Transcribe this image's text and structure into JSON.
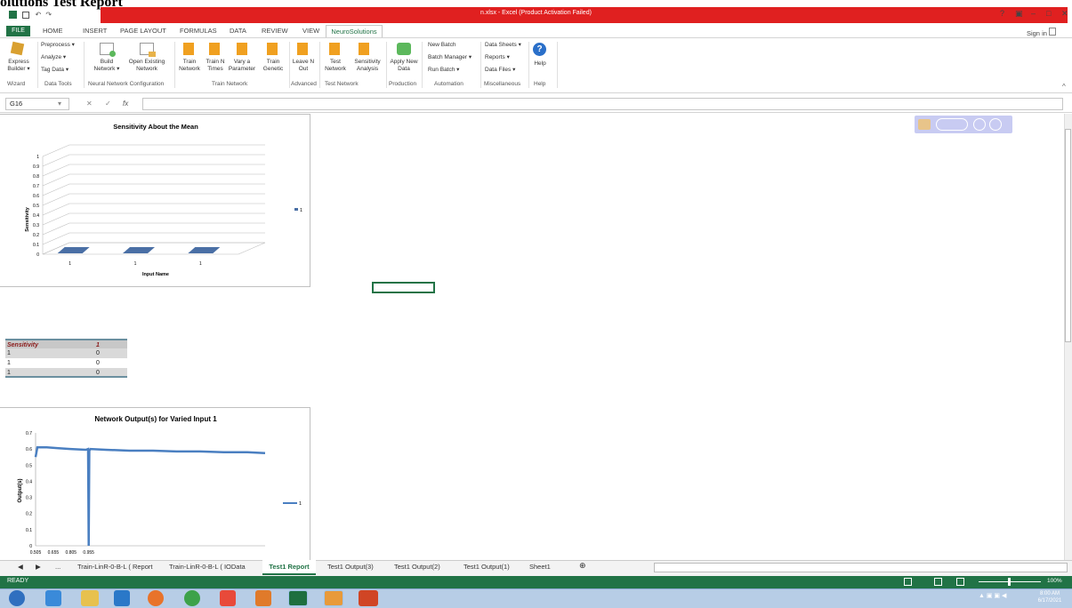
{
  "document_title": "olutions Test Report",
  "window": {
    "title": "n.xlsx - Excel (Product Activation Failed)",
    "controls": [
      "?",
      "▣",
      "–",
      "□",
      "✕"
    ],
    "sign_in": "Sign in"
  },
  "menu_tabs": [
    {
      "label": "FILE"
    },
    {
      "label": "HOME"
    },
    {
      "label": "INSERT"
    },
    {
      "label": "PAGE LAYOUT"
    },
    {
      "label": "FORMULAS"
    },
    {
      "label": "DATA"
    },
    {
      "label": "REVIEW"
    },
    {
      "label": "VIEW"
    },
    {
      "label": "NeuroSolutions"
    }
  ],
  "ribbon": {
    "buttons": {
      "express_builder": "Express Builder ▾",
      "preprocess": "Preprocess ▾",
      "analyze": "Analyze ▾",
      "tag_data": "Tag Data ▾",
      "build_network": "Build Network ▾",
      "open_existing": "Open Existing Network",
      "train_network": "Train Network",
      "train_n_times": "Train N Times",
      "vary_parameter": "Vary a Parameter",
      "train_genetic": "Train Genetic",
      "leave_n_out": "Leave N Out",
      "test_network": "Test Network",
      "sensitivity_analysis": "Sensitivity Analysis",
      "apply_new_data": "Apply New Data",
      "new_batch": "New Batch",
      "batch_manager": "Batch Manager ▾",
      "run_batch": "Run Batch ▾",
      "data_sheets": "Data Sheets ▾",
      "reports": "Reports ▾",
      "data_files": "Data Files ▾",
      "help": "Help"
    },
    "groups": {
      "wizard": "Wizard",
      "data_tools": "Data Tools",
      "nn_config": "Neural Network Configuration",
      "train_network": "Train Network",
      "advanced": "Advanced",
      "test_network": "Test Network",
      "production": "Production",
      "automation": "Automation",
      "miscellaneous": "Miscellaneous",
      "help": "Help"
    }
  },
  "formula_bar": {
    "name_box": "G16",
    "fx_label": "fx",
    "value": ""
  },
  "sensitivity_table": {
    "header": [
      "Sensitivity",
      "1"
    ],
    "rows": [
      [
        "1",
        "0"
      ],
      [
        "1",
        "0"
      ],
      [
        "1",
        "0"
      ]
    ]
  },
  "chart_data": [
    {
      "type": "bar",
      "title": "Sensitivity About the Mean",
      "xlabel": "Input Name",
      "ylabel": "Sensitivity",
      "categories": [
        "1",
        "1",
        "1"
      ],
      "series": [
        {
          "name": "1",
          "values": [
            0,
            0,
            0
          ]
        }
      ],
      "ylim": [
        0,
        1
      ],
      "yticks": [
        "0",
        "0.1",
        "0.2",
        "0.3",
        "0.4",
        "0.5",
        "0.6",
        "0.7",
        "0.8",
        "0.9",
        "1"
      ],
      "grid": true,
      "legend": "right",
      "color": "#4a6fa5"
    },
    {
      "type": "line",
      "title": "Network Output(s) for Varied Input 1",
      "xlabel": "",
      "ylabel": "Output(s)",
      "xticks": [
        "0.505",
        "0.655",
        "0.805",
        "0.955"
      ],
      "yticks": [
        "0",
        "0.1",
        "0.2",
        "0.3",
        "0.4",
        "0.5",
        "0.6",
        "0.7"
      ],
      "ylim": [
        0,
        0.7
      ],
      "series": [
        {
          "name": "1",
          "x": [
            0.505,
            0.52,
            0.6,
            0.7,
            0.8,
            0.93,
            0.95,
            0.955,
            0.96,
            0.97,
            1.1,
            1.3,
            1.5,
            1.7,
            1.9,
            2.1,
            2.3,
            2.45
          ],
          "y": [
            0.55,
            0.61,
            0.61,
            0.605,
            0.6,
            0.595,
            0.6,
            0.0,
            0.59,
            0.6,
            0.595,
            0.59,
            0.59,
            0.585,
            0.585,
            0.58,
            0.58,
            0.575
          ]
        }
      ],
      "xlim": [
        0.505,
        2.45
      ],
      "legend": "right",
      "color": "#4a7fc1"
    }
  ],
  "sheet_tabs": [
    {
      "label": "◀"
    },
    {
      "label": "▶"
    },
    {
      "label": "..."
    },
    {
      "label": "Train-LinR-0-B-L ( Report"
    },
    {
      "label": "Train-LinR-0-B-L ( IOData"
    },
    {
      "label": "Test1 Report"
    },
    {
      "label": "Test1 Output(3)"
    },
    {
      "label": "Test1 Output(2)"
    },
    {
      "label": "Test1 Output(1)"
    },
    {
      "label": "Sheet1"
    },
    {
      "label": "⊕"
    }
  ],
  "status_bar": {
    "status": "READY",
    "zoom": "100%"
  },
  "taskbar": {
    "time": "8:00 AM",
    "date": "6/17/2021"
  }
}
